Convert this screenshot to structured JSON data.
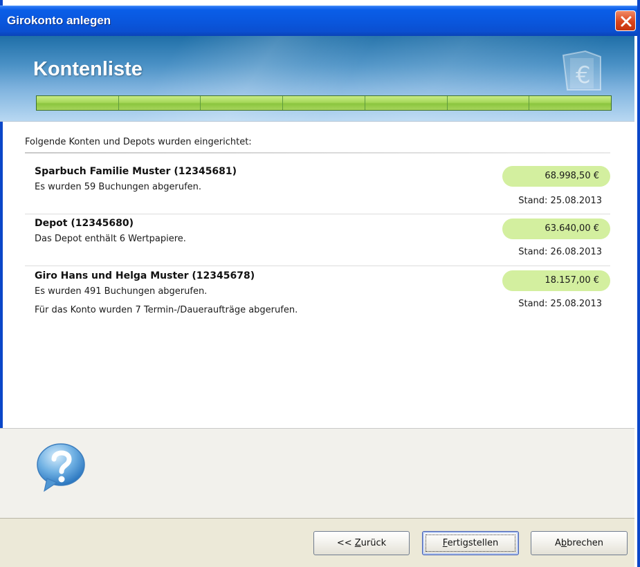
{
  "window": {
    "title": "Girokonto anlegen"
  },
  "header": {
    "heading": "Kontenliste",
    "icon": "euro-document-icon",
    "progress_segments": 7,
    "progress_fraction": 1.0
  },
  "content": {
    "intro": "Folgende Konten und Depots wurden eingerichtet:",
    "accounts": [
      {
        "name": "Sparbuch Familie Muster (12345681)",
        "lines": [
          "Es wurden 59 Buchungen abgerufen."
        ],
        "amount": "68.998,50 €",
        "stand": "Stand: 25.08.2013"
      },
      {
        "name": "Depot (12345680)",
        "lines": [
          "Das Depot enthält 6 Wertpapiere."
        ],
        "amount": "63.640,00 €",
        "stand": "Stand: 26.08.2013"
      },
      {
        "name": "Giro Hans und Helga Muster (12345678)",
        "lines": [
          "Es wurden 491 Buchungen abgerufen.",
          "Für das Konto wurden 7 Termin-/Daueraufträge abgerufen."
        ],
        "amount": "18.157,00 €",
        "stand": "Stand: 25.08.2013"
      }
    ]
  },
  "footer": {
    "help_icon": "help-question-icon",
    "back": {
      "pre": "<< ",
      "mnemonic": "Z",
      "post": "urück"
    },
    "finish": {
      "pre": "",
      "mnemonic": "F",
      "post": "ertigstellen"
    },
    "cancel": {
      "pre": "A",
      "mnemonic": "b",
      "post": "brechen"
    }
  },
  "colors": {
    "titlebar": "#0a56dc",
    "amount_pill": "#d3ef9f",
    "progress_fill": "#a7d85a",
    "close_button": "#d9451c"
  }
}
